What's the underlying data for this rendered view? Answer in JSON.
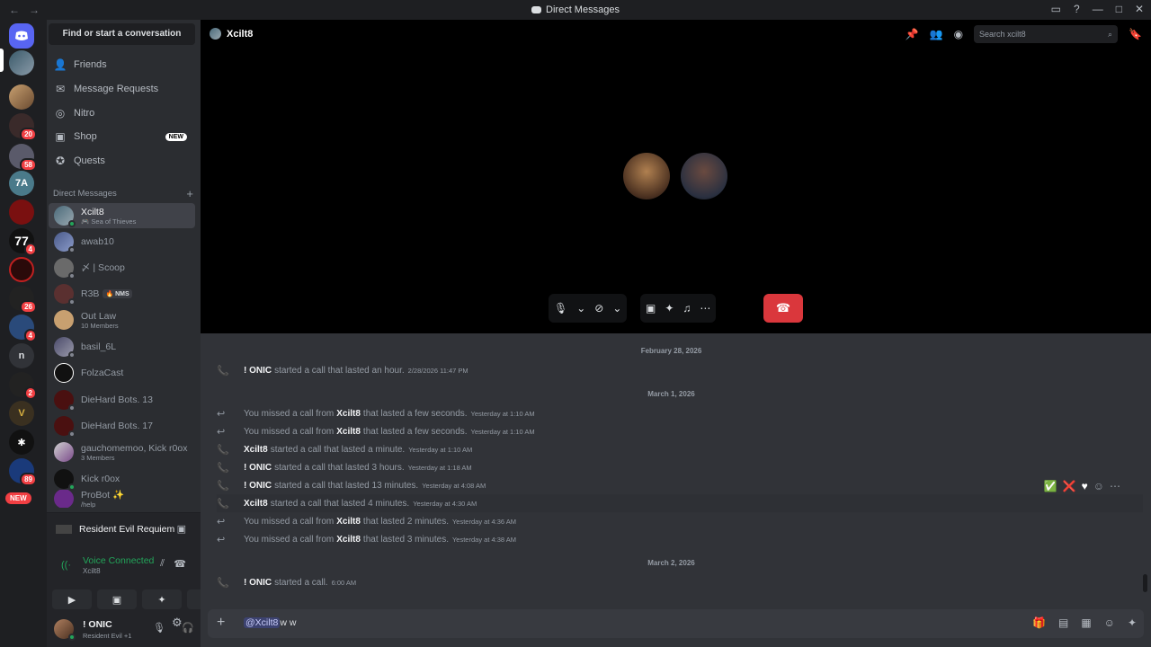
{
  "titlebar": {
    "title": "Direct Messages",
    "back": "←",
    "forward": "→"
  },
  "rail": {
    "new_label": "NEW",
    "badges": [
      "20",
      "58",
      "4",
      "26",
      "4",
      "2",
      "89"
    ],
    "letter_server": "n",
    "num_server": "77"
  },
  "sidebar": {
    "find_label": "Find or start a conversation",
    "nav": [
      {
        "label": "Friends"
      },
      {
        "label": "Message Requests"
      },
      {
        "label": "Nitro"
      },
      {
        "label": "Shop",
        "tag": "NEW"
      },
      {
        "label": "Quests"
      }
    ],
    "dm_header": "Direct Messages",
    "dms": [
      {
        "name": "Xcilt8",
        "sub": "🎮 Sea of Thieves",
        "active": true
      },
      {
        "name": "awab10",
        "sub": ""
      },
      {
        "name": "〆 | Scoop",
        "sub": ""
      },
      {
        "name": "R3B",
        "sub": "",
        "tag": "🔥 NMS"
      },
      {
        "name": "Out Law",
        "sub": "10 Members"
      },
      {
        "name": "basil_6L",
        "sub": ""
      },
      {
        "name": "FolzaCast",
        "sub": ""
      },
      {
        "name": "DieHard Bots. 13",
        "sub": ""
      },
      {
        "name": "DieHard Bots. 17",
        "sub": ""
      },
      {
        "name": "gauchomemoo, Kick r0ox",
        "sub": "3 Members"
      },
      {
        "name": "Kick r0ox",
        "sub": ""
      },
      {
        "name": "ProBot ✨",
        "sub": "/help"
      }
    ],
    "voice": {
      "activity": "Resident Evil Requiem",
      "status": "Voice Connected",
      "channel": "Xcilt8"
    },
    "user": {
      "name": "! ONIC",
      "status": "Resident Evil +1"
    }
  },
  "call": {
    "header_name": "Xcilt8",
    "search_placeholder": "Search xcilt8"
  },
  "messages": {
    "dates": [
      "February 28, 2026",
      "March 1, 2026",
      "March 2, 2026"
    ],
    "items": [
      {
        "name": "! ONIC",
        "text": "started a call that lasted an hour.",
        "ts": "2/28/2026 11:47 PM",
        "missed": false
      },
      {
        "prefix": "You missed a call from",
        "name": "Xcilt8",
        "text": "that lasted a few seconds.",
        "ts": "Yesterday at 1:10 AM",
        "missed": true
      },
      {
        "prefix": "You missed a call from",
        "name": "Xcilt8",
        "text": "that lasted a few seconds.",
        "ts": "Yesterday at 1:10 AM",
        "missed": true
      },
      {
        "name": "Xcilt8",
        "text": "started a call that lasted a minute.",
        "ts": "Yesterday at 1:10 AM",
        "missed": false
      },
      {
        "name": "! ONIC",
        "text": "started a call that lasted 3 hours.",
        "ts": "Yesterday at 1:18 AM",
        "missed": false
      },
      {
        "name": "! ONIC",
        "text": "started a call that lasted 13 minutes.",
        "ts": "Yesterday at 4:08 AM",
        "missed": false
      },
      {
        "name": "Xcilt8",
        "text": "started a call that lasted 4 minutes.",
        "ts": "Yesterday at 4:30 AM",
        "missed": false
      },
      {
        "prefix": "You missed a call from",
        "name": "Xcilt8",
        "text": "that lasted 2 minutes.",
        "ts": "Yesterday at 4:36 AM",
        "missed": true
      },
      {
        "prefix": "You missed a call from",
        "name": "Xcilt8",
        "text": "that lasted 3 minutes.",
        "ts": "Yesterday at 4:38 AM",
        "missed": true
      },
      {
        "name": "! ONIC",
        "text": "started a call.",
        "ts": "6:00 AM",
        "missed": false
      }
    ]
  },
  "composer": {
    "mention": "@Xcilt8",
    "text": "w w"
  },
  "colors": {
    "accent": "#5865f2",
    "green": "#23a55a",
    "red": "#da373c"
  }
}
